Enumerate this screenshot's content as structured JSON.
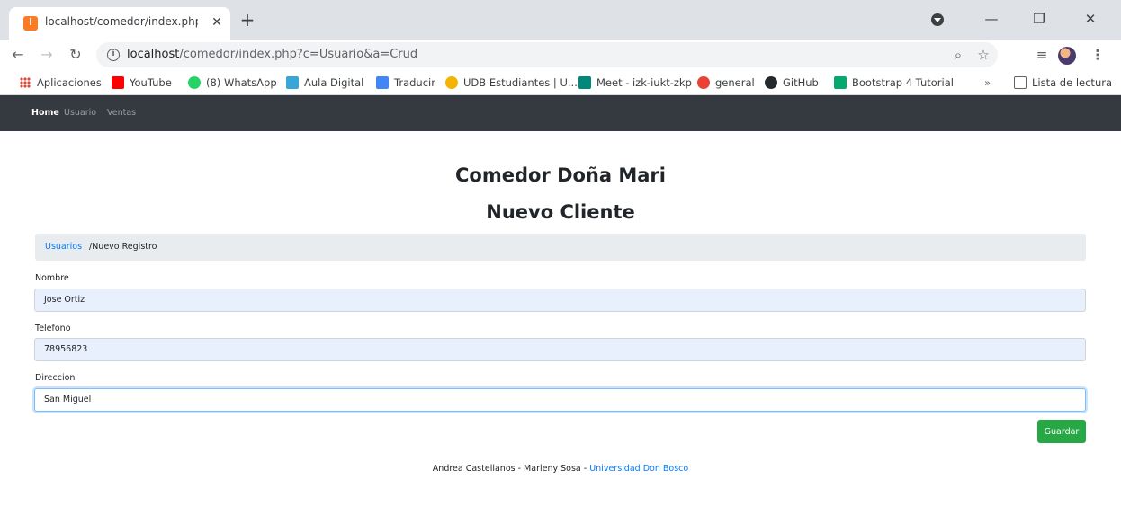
{
  "browser": {
    "tab_title": "localhost/comedor/index.php?c=",
    "url_host": "localhost",
    "url_path": "/comedor/index.php?c=Usuario&a=Crud",
    "bookmarks": [
      {
        "label": "Aplicaciones",
        "icon": "apps-grid-icon",
        "color": "#ea4335"
      },
      {
        "label": "YouTube",
        "icon": "youtube-icon",
        "color": "#ff0000"
      },
      {
        "label": "(8) WhatsApp",
        "icon": "whatsapp-icon",
        "color": "#25d366"
      },
      {
        "label": "Aula Digital",
        "icon": "aula-digital-icon",
        "color": "#3aa6d8"
      },
      {
        "label": "Traducir",
        "icon": "translate-icon",
        "color": "#4285f4"
      },
      {
        "label": "UDB Estudiantes | U...",
        "icon": "udb-icon",
        "color": "#f4b400"
      },
      {
        "label": "Meet - izk-iukt-zkp",
        "icon": "meet-icon",
        "color": "#00897b"
      },
      {
        "label": "general",
        "icon": "general-icon",
        "color": "#ea4335"
      },
      {
        "label": "GitHub",
        "icon": "github-icon",
        "color": "#24292e"
      },
      {
        "label": "Bootstrap 4 Tutorial",
        "icon": "w3schools-icon",
        "color": "#04aa6d"
      }
    ],
    "overflow_label": "»",
    "reading_list_label": "Lista de lectura"
  },
  "navbar": {
    "items": [
      "Home",
      "Usuario",
      "Ventas"
    ]
  },
  "page": {
    "title": "Comedor Doña Mari",
    "subtitle": "Nuevo Cliente",
    "breadcrumb_link": "Usuarios",
    "breadcrumb_current": "/Nuevo Registro"
  },
  "form": {
    "nombre_label": "Nombre",
    "nombre_value": "Jose Ortiz",
    "telefono_label": "Telefono",
    "telefono_value": "78956823",
    "direccion_label": "Direccion",
    "direccion_value": "San Miguel",
    "save_label": "Guardar"
  },
  "footer": {
    "authors": "Andrea Castellanos - Marleny Sosa - ",
    "link": "Universidad Don Bosco"
  },
  "colors": {
    "navbar": "#343a40",
    "link": "#007bff",
    "success": "#28a745",
    "autofill": "#e8f0fe"
  }
}
